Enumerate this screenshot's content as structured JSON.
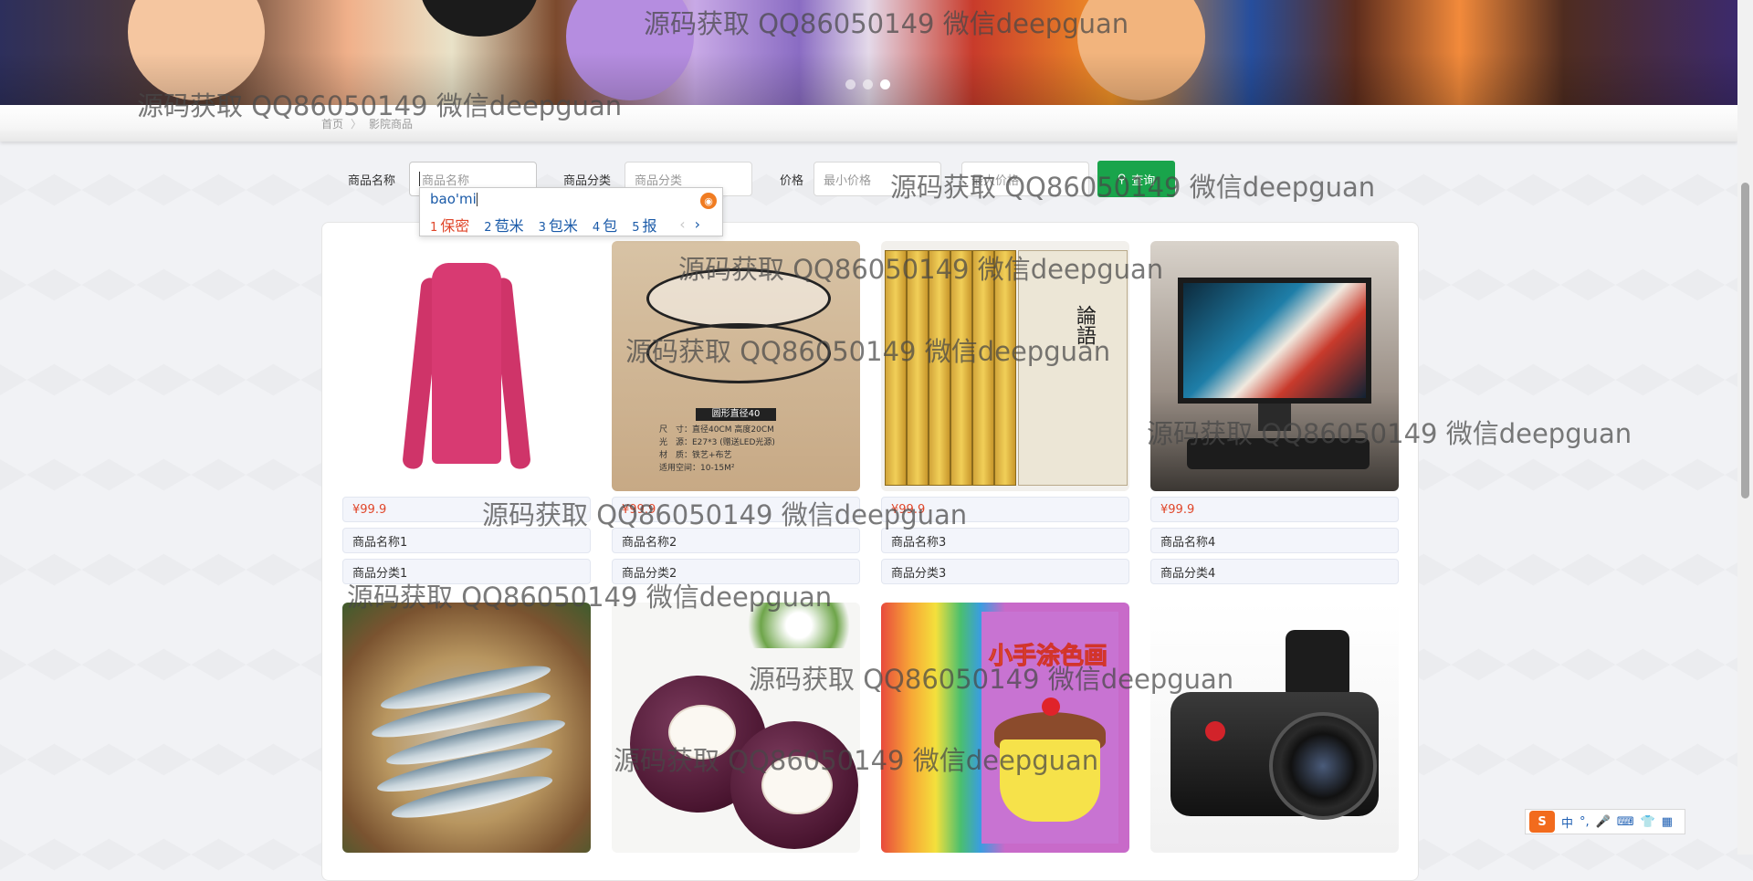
{
  "banner": {
    "dots_count": 3,
    "active_dot": 3
  },
  "breadcrumb": {
    "home": "首页",
    "separator": "〉",
    "current": "影院商品"
  },
  "search": {
    "name_label": "商品名称",
    "name_placeholder": "商品名称",
    "category_label": "商品分类",
    "category_placeholder": "商品分类",
    "price_label": "价格",
    "min_price_placeholder": "最小价格",
    "max_price_placeholder": "最大价格",
    "button_label": "查询"
  },
  "ime_popup": {
    "composition": "bao'mi",
    "candidates": [
      {
        "num": "1",
        "text": "保密"
      },
      {
        "num": "2",
        "text": "苞米"
      },
      {
        "num": "3",
        "text": "包米"
      },
      {
        "num": "4",
        "text": "包"
      },
      {
        "num": "5",
        "text": "报"
      }
    ]
  },
  "products": [
    {
      "price": "¥99.9",
      "name": "商品名称1",
      "category": "商品分类1",
      "image": "pink-sweater"
    },
    {
      "price": "¥99.9",
      "name": "商品名称2",
      "category": "商品分类2",
      "image": "ceiling-lamp"
    },
    {
      "price": "¥99.9",
      "name": "商品名称3",
      "category": "商品分类3",
      "image": "book-set"
    },
    {
      "price": "¥99.9",
      "name": "商品名称4",
      "category": "商品分类4",
      "image": "desktop-computer"
    },
    {
      "image": "fish-basket"
    },
    {
      "image": "mangosteen"
    },
    {
      "image": "coloring-books"
    },
    {
      "image": "camera"
    }
  ],
  "lamp_caption": {
    "title": "圆形直径40",
    "lines": [
      "尺　寸：直径40CM 高度20CM",
      "光　源：E27*3 (赠送LED光源)",
      "材　质：铁艺+布艺",
      "适用空间：10-15M²"
    ]
  },
  "books_label": "論語",
  "coloring_book_title": "小手涂色画",
  "watermark": "源码获取 QQ86050149 微信deepguan",
  "ime_toolbar": {
    "logo": "S",
    "items": [
      "中",
      "°,",
      "🎤",
      "⌨",
      "👕",
      "▦"
    ]
  },
  "colors": {
    "accent_green": "#19a44b",
    "price_red": "#e0462a",
    "ime_blue": "#1a5aa8"
  }
}
